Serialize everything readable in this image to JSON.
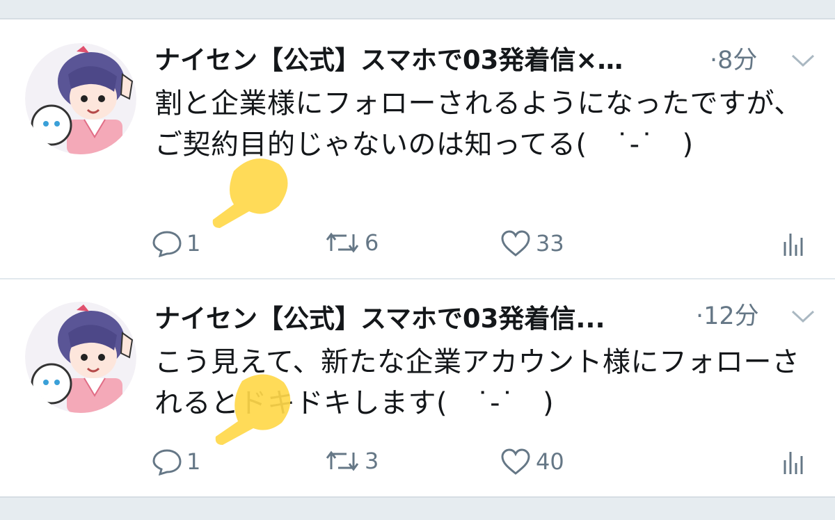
{
  "colors": {
    "text": "#14171a",
    "muted": "#657786",
    "background": "#e6ecf0",
    "highlight": "#ffd84a"
  },
  "tweets": [
    {
      "name": "ナイセン【公式】スマホで03発着信×…",
      "time": "·8分",
      "text": "割と企業様にフォローされるようになったですが、ご契約目的じゃないのは知ってる(　˙-˙　)",
      "replies": "1",
      "retweets": "6",
      "likes": "33",
      "avatar_label": "ナイセン"
    },
    {
      "name": "ナイセン【公式】スマホで03発着信...",
      "time": "·12分",
      "text": "こう見えて、新たな企業アカウント様にフォローされるとドキドキします(　˙-˙　)",
      "replies": "1",
      "retweets": "3",
      "likes": "40",
      "avatar_label": "ナイセン"
    }
  ],
  "icons": {
    "reply": "reply-icon",
    "retweet": "retweet-icon",
    "like": "heart-icon",
    "stats": "analytics-icon",
    "caret": "chevron-down-icon"
  }
}
